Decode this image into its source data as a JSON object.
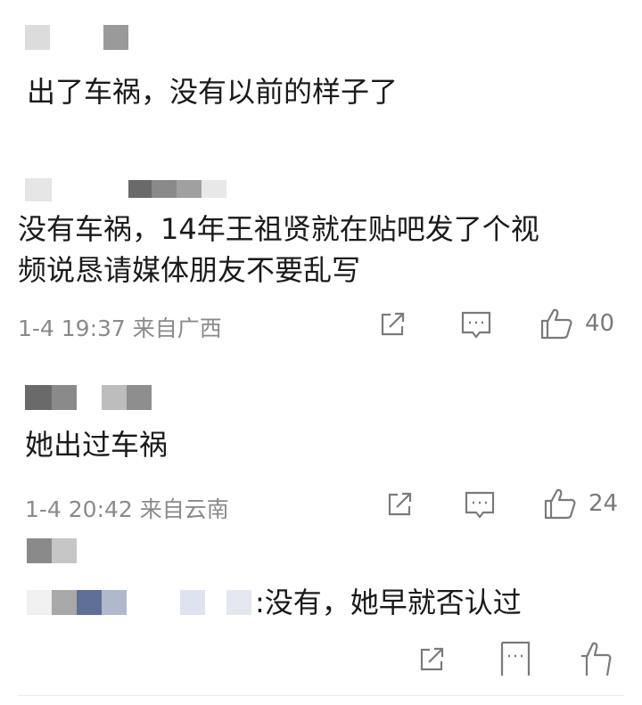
{
  "comments": [
    {
      "text": "出了车祸，没有以前的样子了"
    },
    {
      "text_line1": "没有车祸，14年王祖贤就在贴吧发了个视",
      "text_line2": "频说恳请媒体朋友不要乱写",
      "time": "1-4 19:37",
      "location": "来自广西",
      "likes": "40"
    },
    {
      "text": "她出过车祸",
      "time": "1-4 20:42",
      "location": "来自云南",
      "likes": "24"
    },
    {
      "reply_text": ":没有，她早就否认过"
    }
  ],
  "icons": {
    "share": "share-icon",
    "comment": "comment-icon",
    "like": "thumbs-up-icon"
  },
  "colors": {
    "text": "#1a1a1a",
    "meta": "#8a8a8a",
    "icon": "#7a7a7a"
  }
}
